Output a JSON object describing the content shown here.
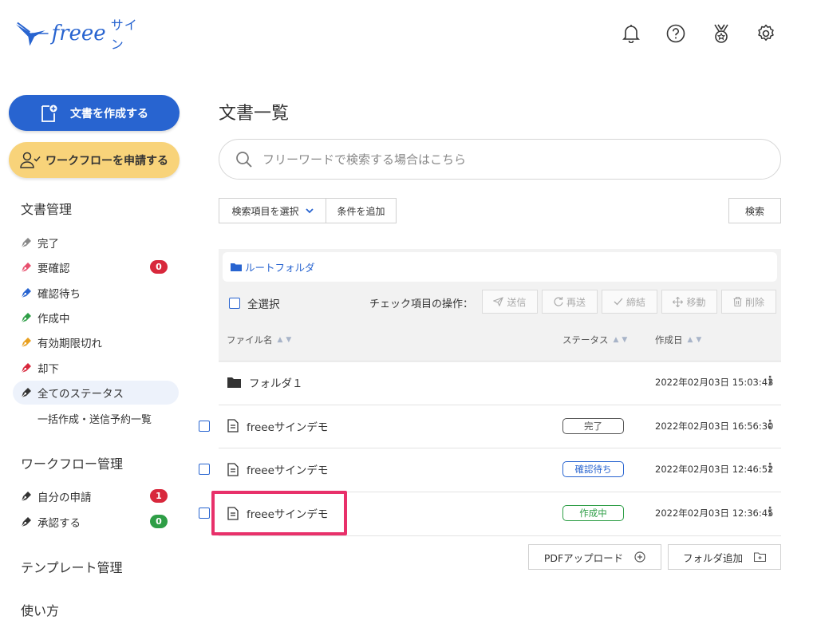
{
  "brand": {
    "logo_word": "freee",
    "logo_suffix": "サイン",
    "color": "#2864d0"
  },
  "header": {
    "icons": [
      "bell-icon",
      "help-icon",
      "medal-icon",
      "gear-icon"
    ]
  },
  "sidebar": {
    "create_button": "文書を作成する",
    "workflow_button": "ワークフローを申請する",
    "doc_section": "文書管理",
    "doc_items": [
      {
        "label": "完了",
        "color": "#888888"
      },
      {
        "label": "要確認",
        "color": "#e8506e",
        "badge": "0",
        "badge_color": "#d8283c"
      },
      {
        "label": "確認待ち",
        "color": "#2864d0"
      },
      {
        "label": "作成中",
        "color": "#2e9e46"
      },
      {
        "label": "有効期限切れ",
        "color": "#e8a020"
      },
      {
        "label": "却下",
        "color": "#d8283c"
      },
      {
        "label": "全てのステータス",
        "color": "#333333",
        "active": true
      }
    ],
    "bulk_item": "一括作成・送信予約一覧",
    "workflow_section": "ワークフロー管理",
    "workflow_items": [
      {
        "label": "自分の申請",
        "badge": "1",
        "badge_color": "#d8283c"
      },
      {
        "label": "承認する",
        "badge": "0",
        "badge_color": "#2e9e46"
      }
    ],
    "template_section": "テンプレート管理",
    "howto_section": "使い方"
  },
  "main": {
    "title": "文書一覧",
    "search_placeholder": "フリーワードで検索する場合はこちら",
    "filter_select": "検索項目を選択",
    "add_condition": "条件を追加",
    "search_button": "検索",
    "breadcrumb": "ルートフォルダ",
    "select_all": "全選択",
    "check_ops_label": "チェック項目の操作：",
    "actions": {
      "send": "送信",
      "resend": "再送",
      "sign": "締結",
      "move": "移動",
      "delete": "削除"
    },
    "columns": {
      "file_name": "ファイル名",
      "status": "ステータス",
      "created": "作成日"
    },
    "rows": [
      {
        "type": "folder",
        "name": "フォルダ１",
        "status": "",
        "date": "2022年02月03日 15:03:43"
      },
      {
        "type": "file",
        "name": "freeeサインデモ",
        "status": "完了",
        "status_color": "#555555",
        "date": "2022年02月03日 16:56:30"
      },
      {
        "type": "file",
        "name": "freeeサインデモ",
        "status": "確認待ち",
        "status_color": "#2864d0",
        "date": "2022年02月03日 12:46:52"
      },
      {
        "type": "file",
        "name": "freeeサインデモ",
        "status": "作成中",
        "status_color": "#2e9e46",
        "date": "2022年02月03日 12:36:45"
      }
    ],
    "pdf_upload": "PDFアップロード",
    "add_folder": "フォルダ追加",
    "highlight_color": "#e8306a"
  }
}
